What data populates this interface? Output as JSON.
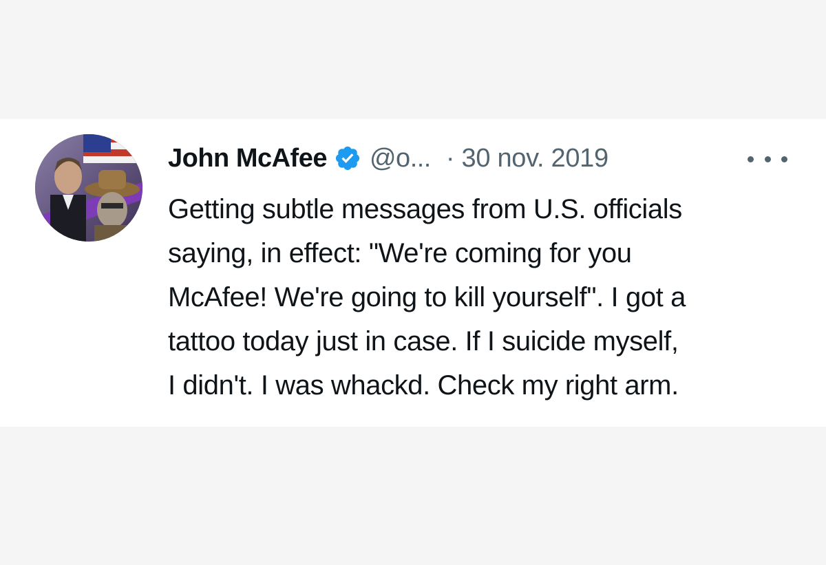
{
  "tweet": {
    "author": {
      "display_name": "John McAfee",
      "handle": "@o...",
      "verified": true,
      "avatar_icon": "profile-avatar"
    },
    "separator": "·",
    "timestamp": "30 nov. 2019",
    "more_icon": "more-options-icon",
    "text_lines": [
      "Getting subtle messages from U.S. officials",
      "saying, in effect: \"We're coming for you",
      "McAfee! We're going to kill yourself\". I got a",
      "tattoo today just in case. If I suicide myself,",
      "I didn't. I was whackd. Check my right arm."
    ]
  },
  "colors": {
    "background": "#f5f5f5",
    "card": "#ffffff",
    "text_primary": "#0f1419",
    "text_secondary": "#536471",
    "verified_blue": "#1d9bf0"
  }
}
